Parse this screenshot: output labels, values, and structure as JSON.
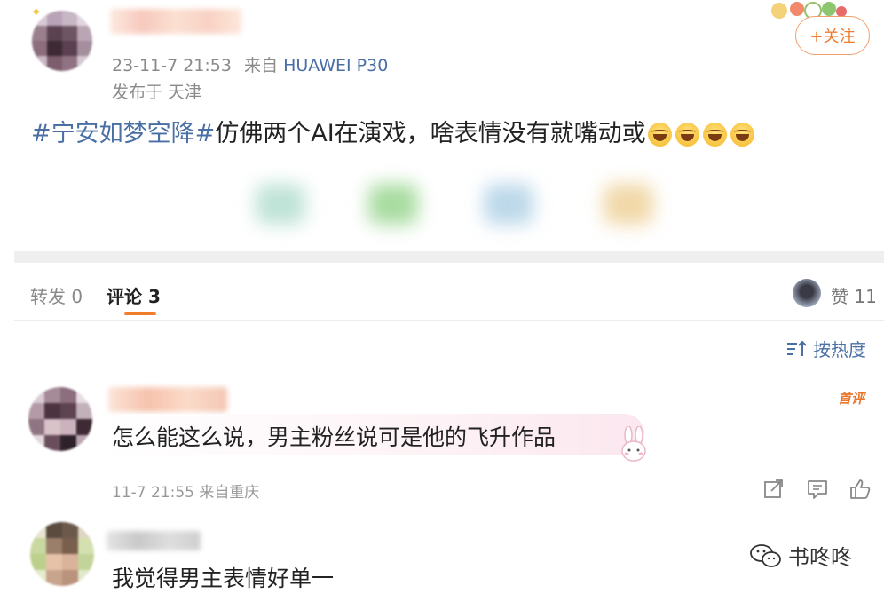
{
  "post": {
    "meta_time": "23-11-7 21:53",
    "meta_from": "来自",
    "device": "HUAWEI P30",
    "location": "发布于 天津",
    "follow_label": "+关注",
    "text_tag": "#宁安如梦空降#",
    "text_body": "仿佛两个AI在演戏，啥表情没有就嘴动或",
    "emoji": [
      "laugh-cry",
      "laugh-cry",
      "laugh-cry",
      "laugh-cry"
    ]
  },
  "tabs": {
    "repost": "转发 0",
    "comments": "评论 3",
    "likes": "赞 11"
  },
  "sort": {
    "label": "按热度"
  },
  "comments": [
    {
      "badge": "首评",
      "text": "怎么能这么说，男主粉丝说可是他的飞升作品",
      "meta": "11-7 21:55 来自重庆"
    },
    {
      "text": "我觉得男主表情好单一"
    }
  ],
  "watermark": {
    "label": "书咚咚"
  },
  "colors": {
    "accent": "#f07d2a",
    "link": "#4a6fa5"
  }
}
